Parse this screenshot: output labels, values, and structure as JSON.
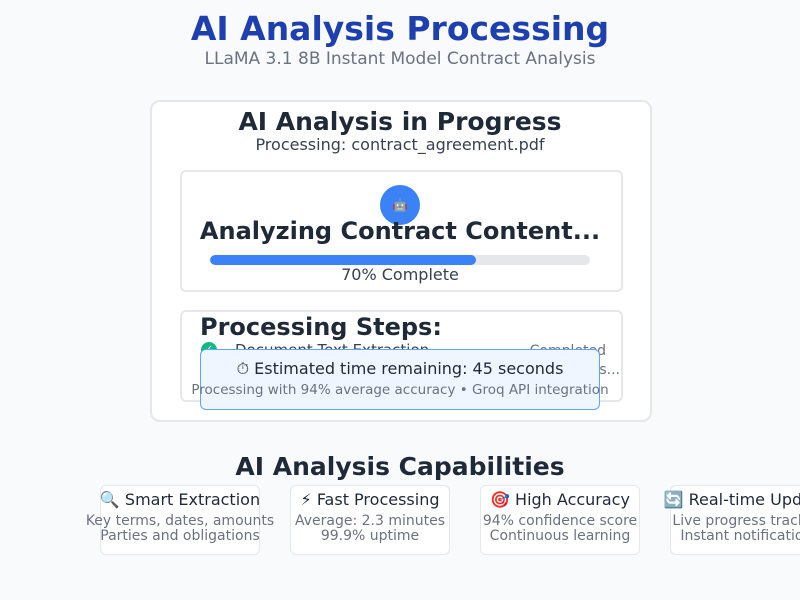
{
  "header": {
    "title": "AI Analysis Processing",
    "subtitle": "LLaMA 3.1 8B Instant Model Contract Analysis"
  },
  "status_card": {
    "heading": "AI Analysis in Progress",
    "file_label": "Processing: contract_agreement.pdf",
    "spinner_icon": "robot-icon",
    "spinner_glyph": "🤖",
    "analyze_title": "Analyzing Contract Content...",
    "progress": 0.7,
    "progress_label": "70% Complete"
  },
  "steps": {
    "title": "Processing Steps:",
    "items": [
      {
        "check_glyph": "✓",
        "name": "Document Text Extraction",
        "status": "Completed"
      },
      {
        "name": "",
        "status": "In Progress..."
      }
    ]
  },
  "estimate": {
    "glyph": "⏱",
    "main": "⏱ Estimated time remaining: 45 seconds",
    "sub": "Processing with 94% average accuracy • Groq API integration"
  },
  "capabilities": {
    "heading": "AI Analysis Capabilities",
    "items": [
      {
        "icon": "magnifier-icon",
        "title": "🔍 Smart Extraction",
        "line1": "Key terms, dates, amounts",
        "line2": "Parties and obligations"
      },
      {
        "icon": "lightning-icon",
        "title": "⚡ Fast Processing",
        "line1": "Average: 2.3 minutes",
        "line2": "99.9% uptime"
      },
      {
        "icon": "target-icon",
        "title": "🎯 High Accuracy",
        "line1": "94% confidence score",
        "line2": "Continuous learning"
      },
      {
        "icon": "refresh-icon",
        "title": "🔄 Real-time Updates",
        "line1": "Live progress tracking",
        "line2": "Instant notifications"
      }
    ]
  },
  "colors": {
    "accent": "#3b82f6",
    "title": "#1e40af",
    "success": "#10b981"
  }
}
